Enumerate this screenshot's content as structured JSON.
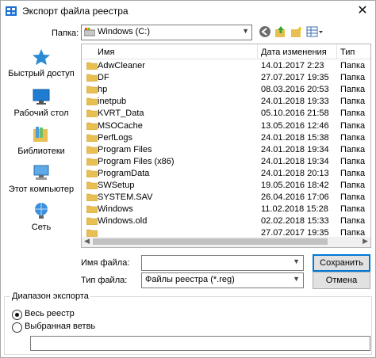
{
  "window": {
    "title": "Экспорт файла реестра",
    "close_glyph": "✕"
  },
  "address": {
    "label": "Папка:",
    "value": "Windows (C:)"
  },
  "places": [
    {
      "label": "Быстрый доступ",
      "icon": "star-icon"
    },
    {
      "label": "Рабочий стол",
      "icon": "desktop-icon"
    },
    {
      "label": "Библиотеки",
      "icon": "library-icon"
    },
    {
      "label": "Этот компьютер",
      "icon": "computer-icon"
    },
    {
      "label": "Сеть",
      "icon": "network-icon"
    }
  ],
  "columns": {
    "name": "Имя",
    "date": "Дата изменения",
    "type": "Тип"
  },
  "files": [
    {
      "name": "AdwCleaner",
      "date": "14.01.2017 2:23",
      "type": "Папка"
    },
    {
      "name": "DF",
      "date": "27.07.2017 19:35",
      "type": "Папка"
    },
    {
      "name": "hp",
      "date": "08.03.2016 20:53",
      "type": "Папка"
    },
    {
      "name": "inetpub",
      "date": "24.01.2018 19:33",
      "type": "Папка"
    },
    {
      "name": "KVRT_Data",
      "date": "05.10.2016 21:58",
      "type": "Папка"
    },
    {
      "name": "MSOCache",
      "date": "13.05.2016 12:46",
      "type": "Папка"
    },
    {
      "name": "PerfLogs",
      "date": "24.01.2018 15:38",
      "type": "Папка"
    },
    {
      "name": "Program Files",
      "date": "24.01.2018 19:34",
      "type": "Папка"
    },
    {
      "name": "Program Files (x86)",
      "date": "24.01.2018 19:34",
      "type": "Папка"
    },
    {
      "name": "ProgramData",
      "date": "24.01.2018 20:13",
      "type": "Папка"
    },
    {
      "name": "SWSetup",
      "date": "19.05.2016 18:42",
      "type": "Папка"
    },
    {
      "name": "SYSTEM.SAV",
      "date": "26.04.2016 17:06",
      "type": "Папка"
    },
    {
      "name": "Windows",
      "date": "11.02.2018 15:28",
      "type": "Папка"
    },
    {
      "name": "Windows.old",
      "date": "02.02.2018 15:33",
      "type": "Папка"
    },
    {
      "name": "",
      "date": "27.07.2017 19:35",
      "type": "Папка"
    }
  ],
  "filename": {
    "label": "Имя файла:",
    "value": ""
  },
  "filetype": {
    "label": "Тип файла:",
    "value": "Файлы реестра (*.reg)"
  },
  "buttons": {
    "save": "Сохранить",
    "cancel": "Отмена"
  },
  "export_range": {
    "title": "Диапазон экспорта",
    "all_label": "Весь реестр",
    "branch_label": "Выбранная ветвь",
    "branch_value": ""
  },
  "colors": {
    "folder": "#e8bf53",
    "accent": "#0078d7"
  }
}
